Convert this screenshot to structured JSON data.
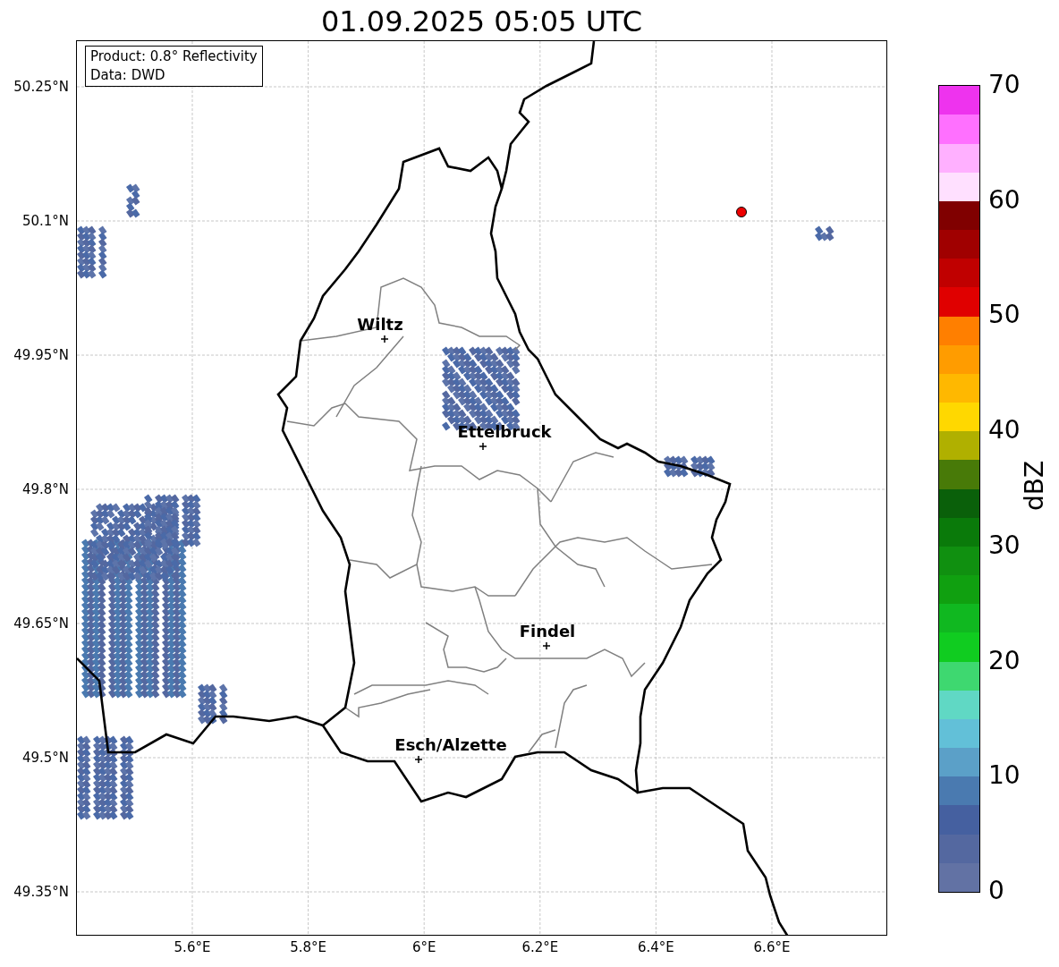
{
  "title": "01.09.2025 05:05 UTC",
  "map": {
    "info_box": [
      "Product: 0.8° Reflectivity",
      "Data: DWD"
    ],
    "lat_ticks": [
      "50.25°N",
      "50.1°N",
      "49.95°N",
      "49.8°N",
      "49.65°N",
      "49.5°N",
      "49.35°N"
    ],
    "lon_ticks": [
      "5.6°E",
      "5.8°E",
      "6°E",
      "6.2°E",
      "6.4°E",
      "6.6°E"
    ],
    "cities": [
      {
        "name": "Wiltz"
      },
      {
        "name": "Ettelbruck"
      },
      {
        "name": "Findel"
      },
      {
        "name": "Esch/Alzette"
      }
    ]
  },
  "colorbar": {
    "label": "dBZ",
    "ticks": [
      "70",
      "60",
      "50",
      "40",
      "30",
      "20",
      "10",
      "0"
    ],
    "segments": [
      {
        "color": "#6272a4"
      },
      {
        "color": "#5468a0"
      },
      {
        "color": "#4560a0"
      },
      {
        "color": "#4a7ab0"
      },
      {
        "color": "#5ba0c8"
      },
      {
        "color": "#62c0d8"
      },
      {
        "color": "#60d8c4"
      },
      {
        "color": "#3ed870"
      },
      {
        "color": "#10cc20"
      },
      {
        "color": "#10b820"
      },
      {
        "color": "#10a010"
      },
      {
        "color": "#109010"
      },
      {
        "color": "#0a7a0a"
      },
      {
        "color": "#0a600a"
      },
      {
        "color": "#487a08"
      },
      {
        "color": "#b0b000"
      },
      {
        "color": "#ffd800"
      },
      {
        "color": "#ffb800"
      },
      {
        "color": "#ff9c00"
      },
      {
        "color": "#ff7f00"
      },
      {
        "color": "#e00000"
      },
      {
        "color": "#c00000"
      },
      {
        "color": "#a00000"
      },
      {
        "color": "#800000"
      },
      {
        "color": "#ffe0ff"
      },
      {
        "color": "#ffb0ff"
      },
      {
        "color": "#ff70ff"
      },
      {
        "color": "#ee33ee"
      }
    ]
  }
}
